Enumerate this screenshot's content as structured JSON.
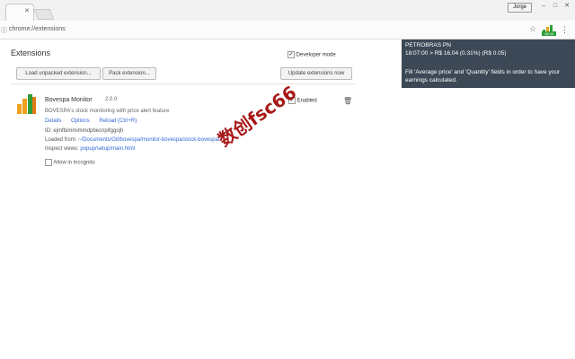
{
  "browser": {
    "user_button": "Jorge",
    "url": "chrome://extensions",
    "window_controls": [
      "–",
      "□",
      "✕"
    ]
  },
  "extensions_page": {
    "title": "Extensions",
    "developer_mode_label": "Developer mode",
    "developer_mode_checked": true,
    "buttons": {
      "load_unpacked": "Load unpacked extension...",
      "pack_extension": "Pack extension...",
      "update_now": "Update extensions now"
    }
  },
  "extension": {
    "name": "Bovespa Monitor",
    "version": "2.0.0",
    "description": "BOVESPA's stock monitoring with price alert feature",
    "links": [
      "Details",
      "Options",
      "Reload (Ctrl+R)"
    ],
    "id_label": "ID: ejmfbimmimmdpbecnpifggojh",
    "loaded_from_label": "Loaded from:",
    "loaded_from_path": "~/Documents/Git/bovespa/monitor-bovespa/stock-bovespa/",
    "inspect_label": "Inspect views:",
    "inspect_link": "popup/setup/main.html",
    "incognito_label": "Allow in incognito",
    "enabled_label": "Enabled",
    "enabled_checked": true
  },
  "popup": {
    "ticker": "PETROBRAS PN",
    "quote": "18:07:00 > R$ 16.04 (0.31%) (R$ 0.05)",
    "hint": "Fill 'Average price' and 'Quantity' fields in order to have your earnings calculated.",
    "badge": "16.04"
  },
  "watermark": "数创fsc66",
  "colors": {
    "link": "#3367d6",
    "popup_bg": "#3c4856",
    "watermark": "#9e0000"
  }
}
